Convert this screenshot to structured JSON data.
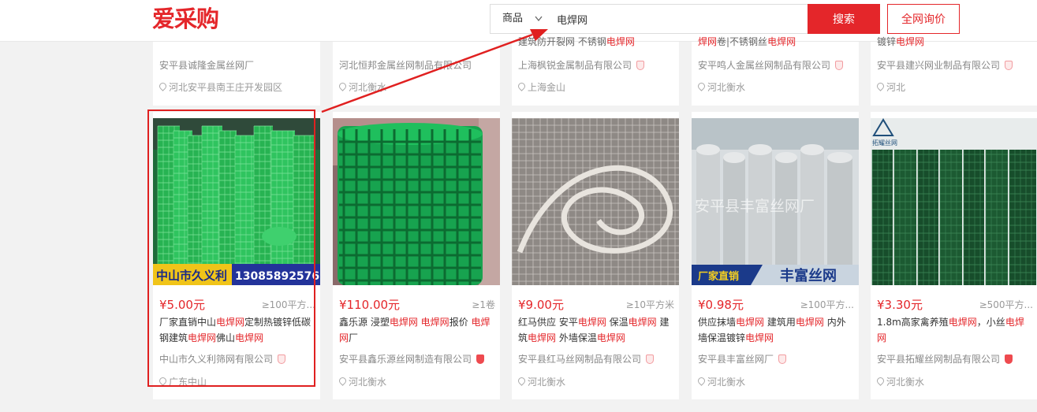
{
  "header": {
    "logo": "爱采购",
    "search_type": "商品",
    "search_query": "电焊网",
    "search_button": "搜索",
    "inquiry_button": "全网询价"
  },
  "top_row": [
    {
      "title_cut": [
        {
          "t": "",
          "kw": false
        }
      ],
      "company": "安平县诚隆金属丝网厂",
      "badge": "none",
      "location": "河北安平县南王庄开发园区"
    },
    {
      "title_cut": [
        {
          "t": "",
          "kw": false
        }
      ],
      "company": "河北恒邦金属丝网制品有限公司",
      "badge": "none",
      "location": "河北衡水"
    },
    {
      "title_cut": [
        {
          "t": "建筑防开裂网 不锈钢",
          "kw": false
        },
        {
          "t": "电焊网",
          "kw": true
        }
      ],
      "company": "上海枫锐金属制品有限公司",
      "badge": "light",
      "location": "上海金山"
    },
    {
      "title_cut": [
        {
          "t": "焊网",
          "kw": true
        },
        {
          "t": "卷|不锈钢丝",
          "kw": false
        },
        {
          "t": "电焊网",
          "kw": true
        }
      ],
      "company": "安平鸣人金属丝网制品有限公司",
      "badge": "light",
      "location": "河北衡水"
    },
    {
      "title_cut": [
        {
          "t": "镀锌",
          "kw": false
        },
        {
          "t": "电焊网",
          "kw": true
        }
      ],
      "company": "安平县建兴网业制品有限公司",
      "badge": "light",
      "location": "河北"
    }
  ],
  "products": [
    {
      "price": "¥5.00元",
      "moq": "≥100平方...",
      "title": [
        {
          "t": "厂家直销中山",
          "kw": false
        },
        {
          "t": "电焊网",
          "kw": true
        },
        {
          "t": "定制热镀锌低碳钢建筑",
          "kw": false
        },
        {
          "t": "电焊网",
          "kw": true
        },
        {
          "t": "佛山",
          "kw": false
        },
        {
          "t": "电焊网",
          "kw": true
        }
      ],
      "company": "中山市久义利筛网有限公司",
      "badge": "light",
      "location": "广东中山",
      "image_overlay": {
        "left": "中山市久义利",
        "right": "13085892576"
      }
    },
    {
      "price": "¥110.00元",
      "moq": "≥1卷",
      "title": [
        {
          "t": "鑫乐源 浸塑",
          "kw": false
        },
        {
          "t": "电焊网",
          "kw": true
        },
        {
          "t": " ",
          "kw": false
        },
        {
          "t": "电焊网",
          "kw": true
        },
        {
          "t": "报价 ",
          "kw": false
        },
        {
          "t": "电焊网",
          "kw": true
        },
        {
          "t": "厂",
          "kw": false
        }
      ],
      "company": "安平县鑫乐源丝网制造有限公司",
      "badge": "strong",
      "location": "河北衡水",
      "image_overlay": null
    },
    {
      "price": "¥9.00元",
      "moq": "≥10平方米",
      "title": [
        {
          "t": "红马供应 安平",
          "kw": false
        },
        {
          "t": "电焊网",
          "kw": true
        },
        {
          "t": " 保温",
          "kw": false
        },
        {
          "t": "电焊网",
          "kw": true
        },
        {
          "t": " 建筑",
          "kw": false
        },
        {
          "t": "电焊网",
          "kw": true
        },
        {
          "t": " 外墙保温",
          "kw": false
        },
        {
          "t": "电焊网",
          "kw": true
        }
      ],
      "company": "安平县红马丝网制品有限公司",
      "badge": "light",
      "location": "河北衡水",
      "image_overlay": null
    },
    {
      "price": "¥0.98元",
      "moq": "≥100平方...",
      "title": [
        {
          "t": "供应抹墙",
          "kw": false
        },
        {
          "t": "电焊网",
          "kw": true
        },
        {
          "t": " 建筑用",
          "kw": false
        },
        {
          "t": "电焊网",
          "kw": true
        },
        {
          "t": " 内外墙保温镀锌",
          "kw": false
        },
        {
          "t": "电焊网",
          "kw": true
        }
      ],
      "company": "安平县丰富丝网厂",
      "badge": "light",
      "location": "河北衡水",
      "image_overlay": {
        "watermark": "安平县丰富丝网厂",
        "left": "厂家直销",
        "right": "丰富丝网"
      }
    },
    {
      "price": "¥3.30元",
      "moq": "≥500平方...",
      "title": [
        {
          "t": "1.8m高家禽养殖",
          "kw": false
        },
        {
          "t": "电焊网",
          "kw": true
        },
        {
          "t": "，小丝",
          "kw": false
        },
        {
          "t": "电焊网",
          "kw": true
        }
      ],
      "company": "安平县拓耀丝网制品有限公司",
      "badge": "strong",
      "location": "河北衡水",
      "image_overlay": {
        "logo": "拓耀丝网"
      }
    }
  ],
  "colors": {
    "brand_red": "#e4262a",
    "mesh_green": "#22b35a",
    "annotation_red": "#e02020"
  }
}
